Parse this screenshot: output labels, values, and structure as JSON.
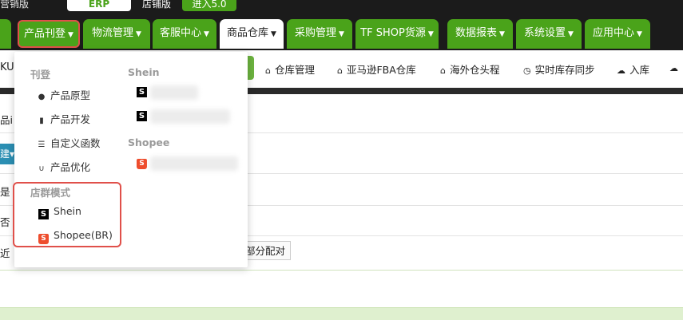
{
  "top_bar": {
    "left_label": "营销版",
    "erp_label": "ERP",
    "store_label": "店铺版",
    "enter_label": "进入5.0"
  },
  "nav": {
    "tabs": [
      {
        "label": "产品刊登",
        "caret": "▼"
      },
      {
        "label": "物流管理",
        "caret": "▼"
      },
      {
        "label": "客服中心",
        "caret": "▼"
      },
      {
        "label": "商品仓库",
        "caret": "▼"
      },
      {
        "label": "采购管理",
        "caret": "▼"
      },
      {
        "label": "TF SHOP货源",
        "caret": "▼"
      },
      {
        "label": "数据报表",
        "caret": "▼"
      },
      {
        "label": "系统设置",
        "caret": "▼"
      },
      {
        "label": "应用中心",
        "caret": "▼"
      }
    ]
  },
  "subnav": {
    "left_fragment": "KU",
    "items": [
      {
        "label": "仓库管理",
        "icon": "home-icon"
      },
      {
        "label": "亚马逊FBA仓库",
        "icon": "home-icon"
      },
      {
        "label": "海外仓头程",
        "icon": "home-icon"
      },
      {
        "label": "实时库存同步",
        "icon": "clock-icon"
      },
      {
        "label": "入库",
        "icon": "cloud-upload-icon"
      }
    ]
  },
  "background": {
    "fragment_product": "品i",
    "fragment_btn": "建",
    "fragment_yes": "是",
    "fragment_no": "否",
    "fragment_near": "近",
    "partial_match": "部分配对"
  },
  "dropdown": {
    "listing_heading": "刊登",
    "listing_items": [
      {
        "label": "产品原型",
        "icon": "circle-icon"
      },
      {
        "label": "产品开发",
        "icon": "signal-icon"
      },
      {
        "label": "自定义函数",
        "icon": "list-icon"
      },
      {
        "label": "产品优化",
        "icon": "stethoscope-icon"
      }
    ],
    "store_mode_heading": "店群模式",
    "store_mode_items": [
      {
        "label": "Shein",
        "logo": "S"
      },
      {
        "label": "Shopee(BR)",
        "logo": "S"
      }
    ],
    "shein_heading": "Shein",
    "shopee_heading": "Shopee",
    "shein_logo": "S",
    "shopee_logo": "S"
  },
  "colors": {
    "nav_green": "#4aa31a",
    "nav_dark": "#1b1b1b",
    "highlight_red": "#e0504a",
    "shopee_orange": "#ee4d2d"
  }
}
